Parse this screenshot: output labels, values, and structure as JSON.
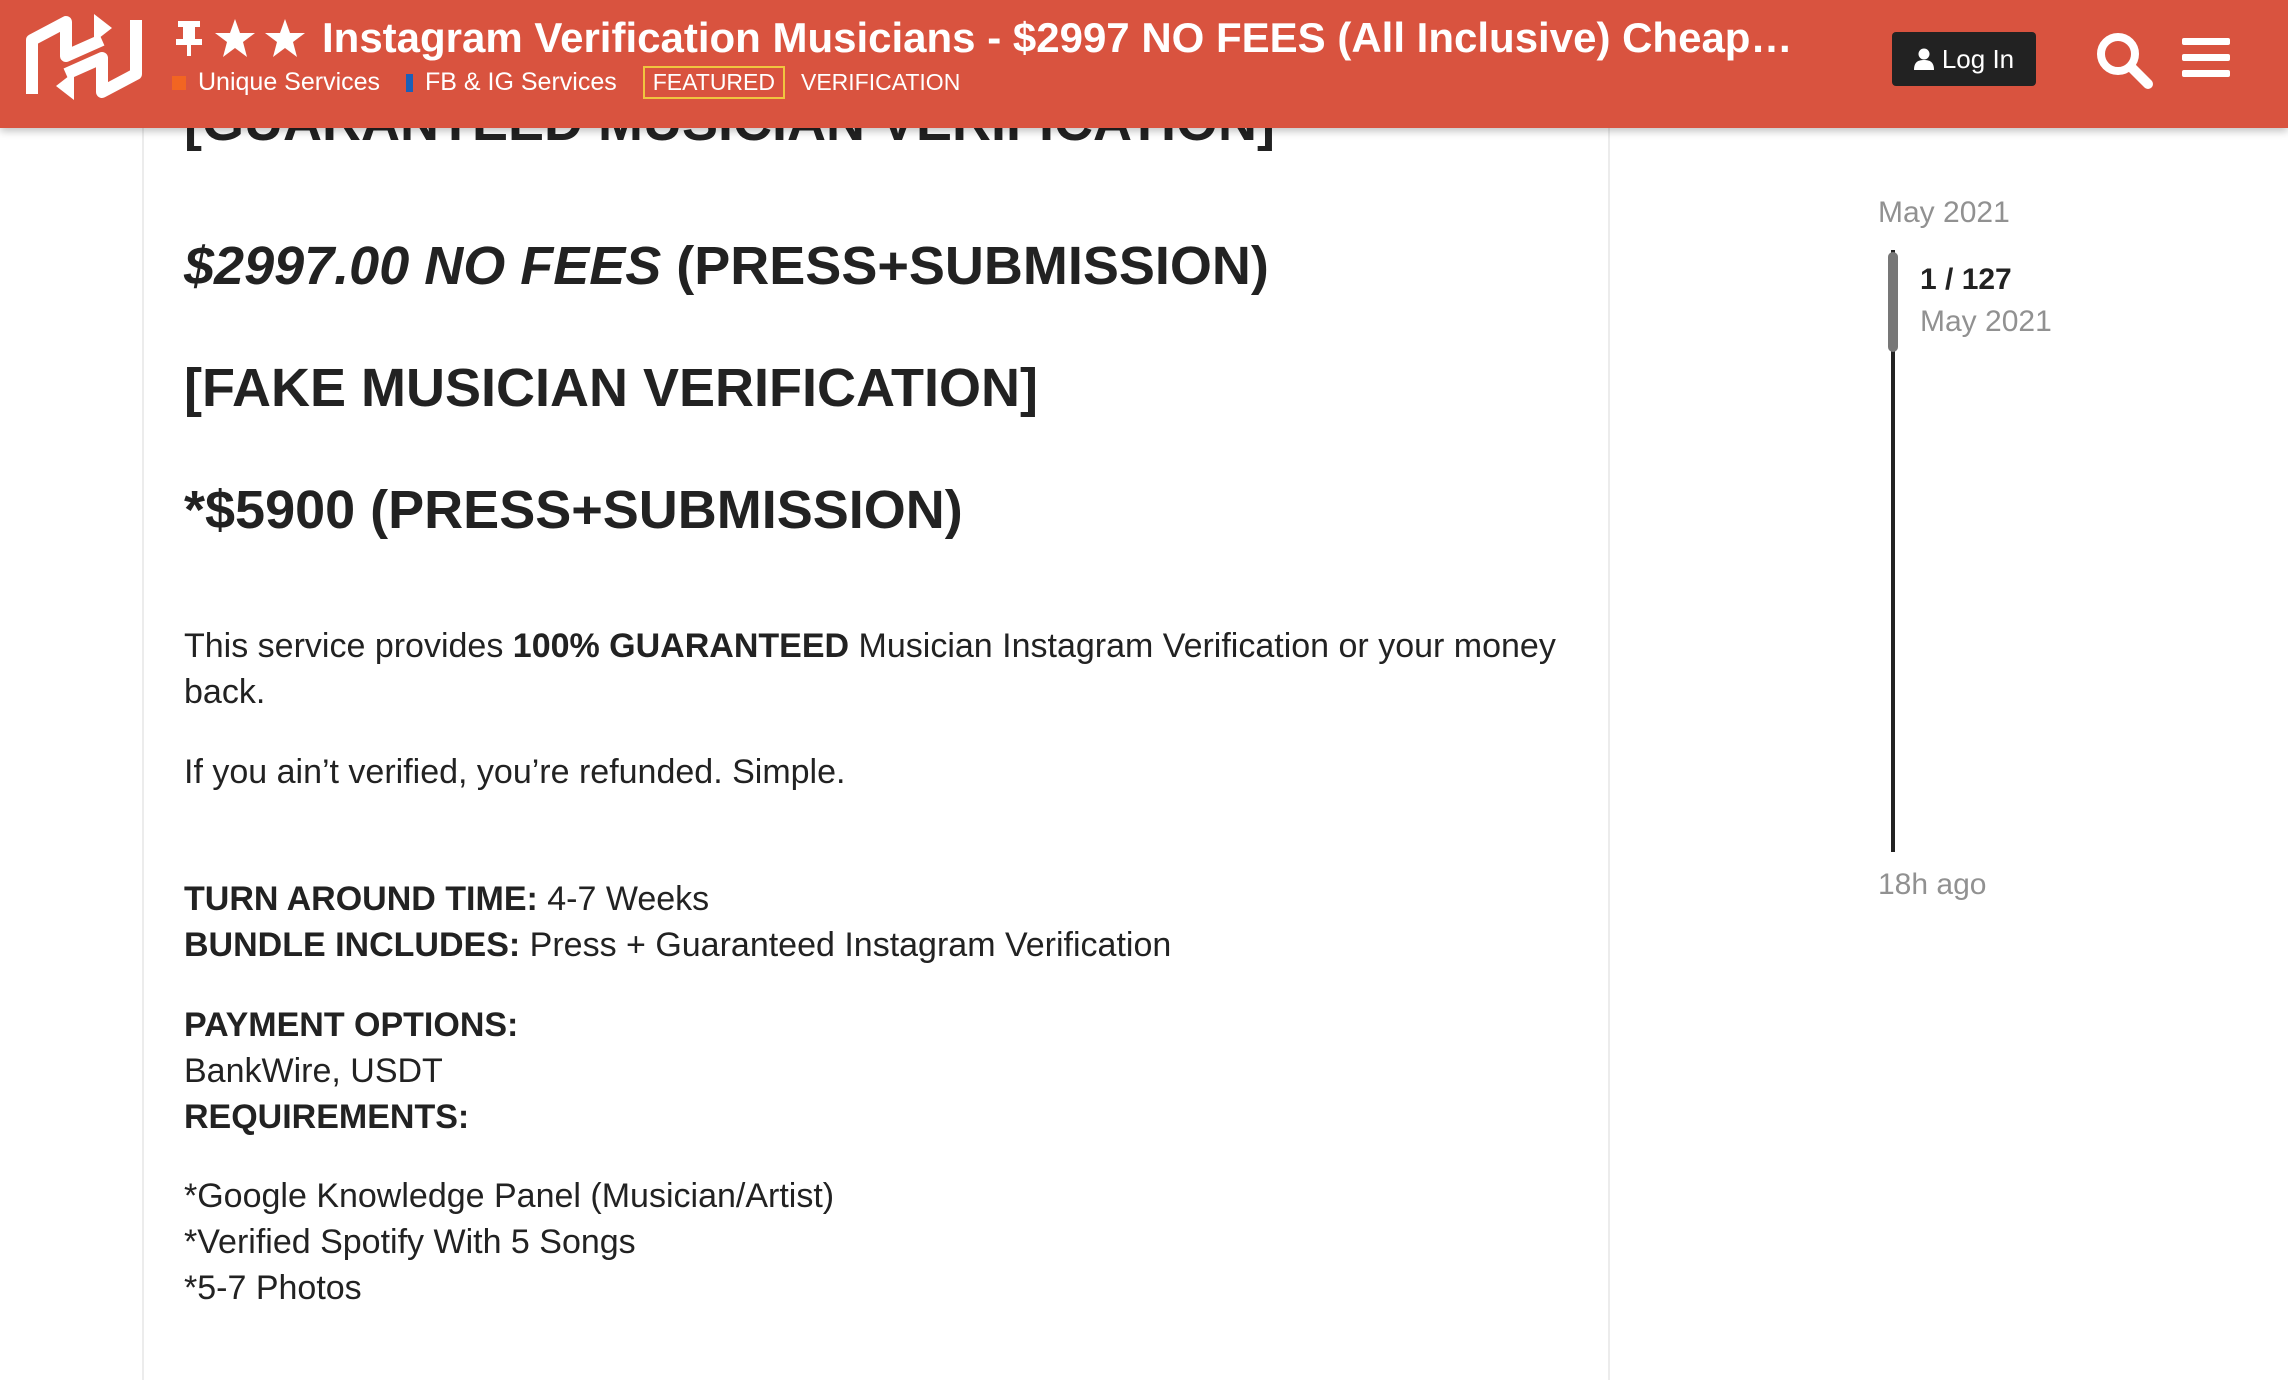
{
  "header": {
    "title": "Instagram Verification Musicians - $2997 NO FEES (All Inclusive) Cheapest o…",
    "login_label": "Log In",
    "categories": [
      {
        "label": "Unique Services",
        "color": "#f26522"
      },
      {
        "label": "FB & IG Services",
        "color": "#1b5fb8"
      }
    ],
    "tags": [
      "FEATURED",
      "VERIFICATION"
    ],
    "icons": [
      "logo",
      "pin-icon",
      "star-icon",
      "star-icon",
      "user-icon",
      "search-icon",
      "hamburger-menu-icon"
    ]
  },
  "post": {
    "heading_partial": "[GUARANTEED MUSICIAN VERIFICATION]",
    "price1_italic": "$2997.00 NO FEES",
    "price1_rest": " (PRESS+SUBMISSION)",
    "heading_fake": "[FAKE MUSICIAN VERIFICATION]",
    "price2": "*$5900 (PRESS+SUBMISSION)",
    "intro_pre": "This service provides ",
    "intro_bold": "100% GUARANTEED",
    "intro_post": " Musician Instagram Verification or your money back.",
    "refund": "If you ain’t verified, you’re refunded. Simple.",
    "turnaround_label": "TURN AROUND TIME:",
    "turnaround_value": " 4-7 Weeks",
    "bundle_label": "BUNDLE INCLUDES:",
    "bundle_value": " Press + Guaranteed Instagram Verification",
    "payment_label": "PAYMENT OPTIONS:",
    "payment_value": "BankWire, USDT",
    "requirements_label": "REQUIREMENTS:",
    "requirements": [
      "*Google Knowledge Panel (Musician/Artist)",
      "*Verified Spotify With 5 Songs",
      "*5-7 Photos"
    ]
  },
  "timeline": {
    "start_date": "May 2021",
    "position": "1 / 127",
    "position_date": "May 2021",
    "end_label": "18h ago"
  },
  "colors": {
    "header_bg": "#d9533f",
    "featured_border": "#f0c53f",
    "button_bg": "#222222"
  }
}
